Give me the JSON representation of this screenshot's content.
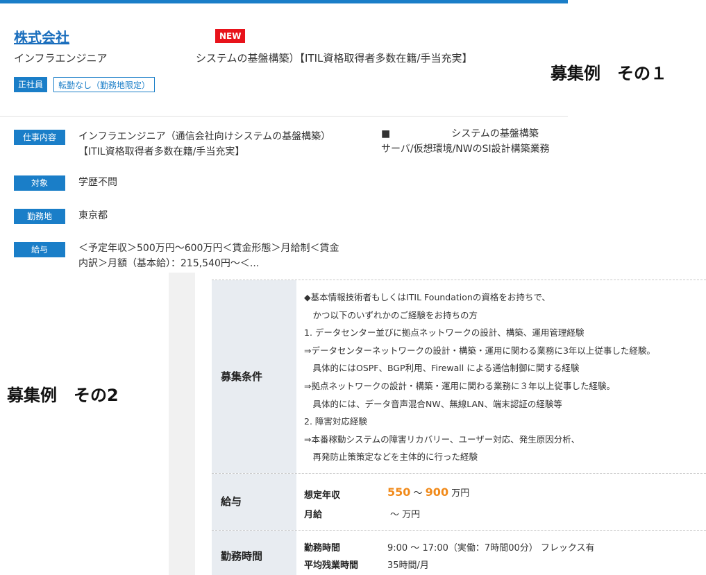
{
  "example1": {
    "company_name": "株式会社",
    "new_badge": "NEW",
    "job_title_left": "インフラエンジニア",
    "job_title_right": "システムの基盤構築）【ITIL資格取得者多数在籍/手当充実】",
    "tags": [
      "正社員",
      "転勤なし（勤務地限定）"
    ],
    "label": "募集例　その１",
    "rows": {
      "job": {
        "label": "仕事内容",
        "line1": "インフラエンジニア（通信会社向けシステムの基盤構築）",
        "line2": "【ITIL資格取得者多数在籍/手当充実】",
        "right_marker": "■",
        "right_line1": "システムの基盤構築",
        "right_line2": "サーバ/仮想環境/NWのSI設計構築業務"
      },
      "target": {
        "label": "対象",
        "text": "学歴不問"
      },
      "location": {
        "label": "勤務地",
        "text": "東京都"
      },
      "salary": {
        "label": "給与",
        "line1": "＜予定年収＞500万円〜600万円＜賃金形態＞月給制＜賃金",
        "line2": "内訳＞月額（基本給）：215,540円〜＜..."
      }
    }
  },
  "example2": {
    "label": "募集例　その2",
    "conditions": {
      "header": "募集条件",
      "lines": [
        "◆基本情報技術者もしくはITIL Foundationの資格をお持ちで、",
        "　かつ以下のいずれかのご経験をお持ちの方",
        "1. データセンター並びに拠点ネットワークの設計、構築、運用管理経験",
        "⇒データセンターネットワークの設計・構築・運用に関わる業務に3年以上従事した経験。",
        "　具体的にはOSPF、BGP利用、Firewall による通信制御に関する経験",
        "⇒拠点ネットワークの設計・構築・運用に関わる業務に３年以上従事した経験。",
        "　具体的には、データ音声混合NW、無線LAN、端末認証の経験等",
        "2. 障害対応経験",
        "⇒本番稼動システムの障害リカバリー、ユーザー対応、発生原因分析、",
        "　再発防止策策定などを主体的に行った経験"
      ]
    },
    "salary": {
      "header": "給与",
      "annual_label": "想定年収",
      "annual_min": "550",
      "annual_sep": " 〜 ",
      "annual_max": "900",
      "annual_unit": " 万円",
      "monthly_label": "月給",
      "monthly_value": "〜 万円"
    },
    "hours": {
      "header": "勤務時間",
      "work_label": "勤務時間",
      "work_value": "9:00 〜 17:00（実働：7時間00分） フレックス有",
      "overtime_label": "平均残業時間",
      "overtime_value": "35時間/月"
    }
  },
  "colors": {
    "accent": "#1a7ec8",
    "new_badge": "#e8131b",
    "salary_number": "#f18a1a",
    "header_bg": "#e8ecf1"
  }
}
